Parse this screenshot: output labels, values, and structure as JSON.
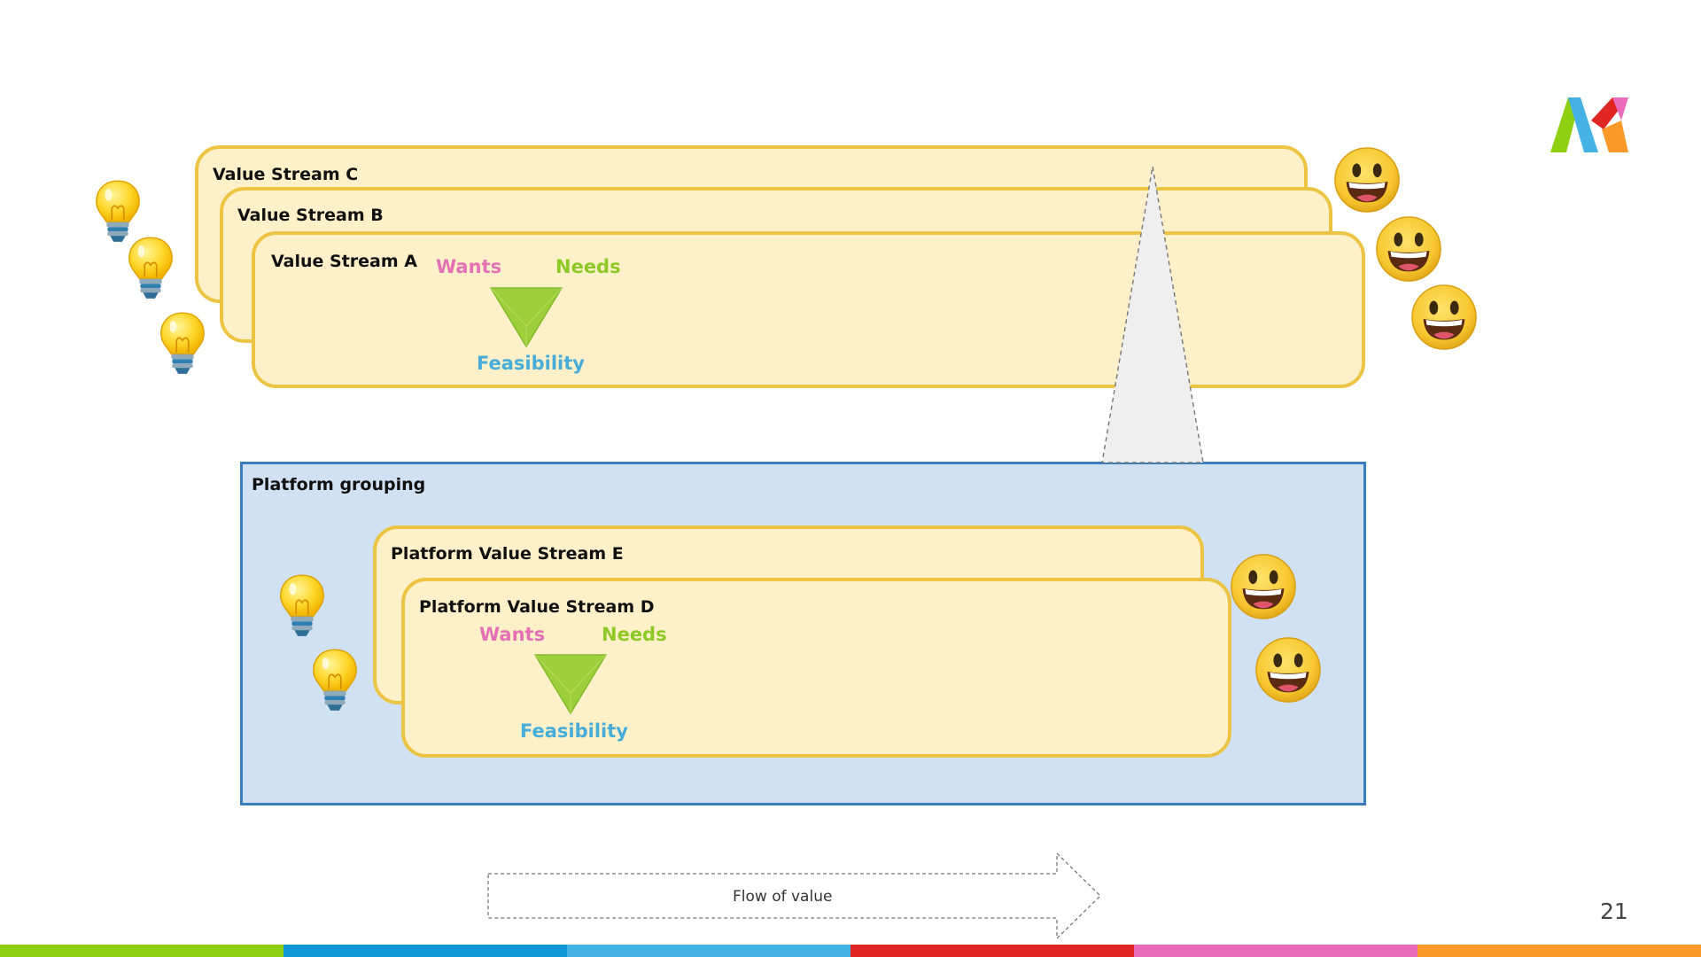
{
  "value_streams": [
    {
      "title": "Value Stream C"
    },
    {
      "title": "Value Stream B"
    },
    {
      "title": "Value Stream A",
      "wants": "Wants",
      "needs": "Needs",
      "feasibility": "Feasibility"
    }
  ],
  "platform": {
    "title": "Platform grouping",
    "streams": [
      {
        "title": "Platform Value Stream E"
      },
      {
        "title": "Platform Value Stream D",
        "wants": "Wants",
        "needs": "Needs",
        "feasibility": "Feasibility"
      }
    ]
  },
  "flow": {
    "label": "Flow of value"
  },
  "page_number": "21",
  "icons": [
    "lightbulb-icon",
    "smiley-icon",
    "triangle-icon",
    "logo-icon"
  ],
  "colors": {
    "stream_fill": "#fef0c8",
    "stream_border": "#ecc444",
    "platform_fill": "#cfe1f3",
    "platform_border": "#3b7ec0",
    "wants": "#e470b6",
    "needs": "#8cc926",
    "feasibility": "#46acd9",
    "bottom_bar": [
      "#8ed011",
      "#0f97d8",
      "#45b2e6",
      "#e02623",
      "#ea6bb8",
      "#fa9828"
    ]
  }
}
